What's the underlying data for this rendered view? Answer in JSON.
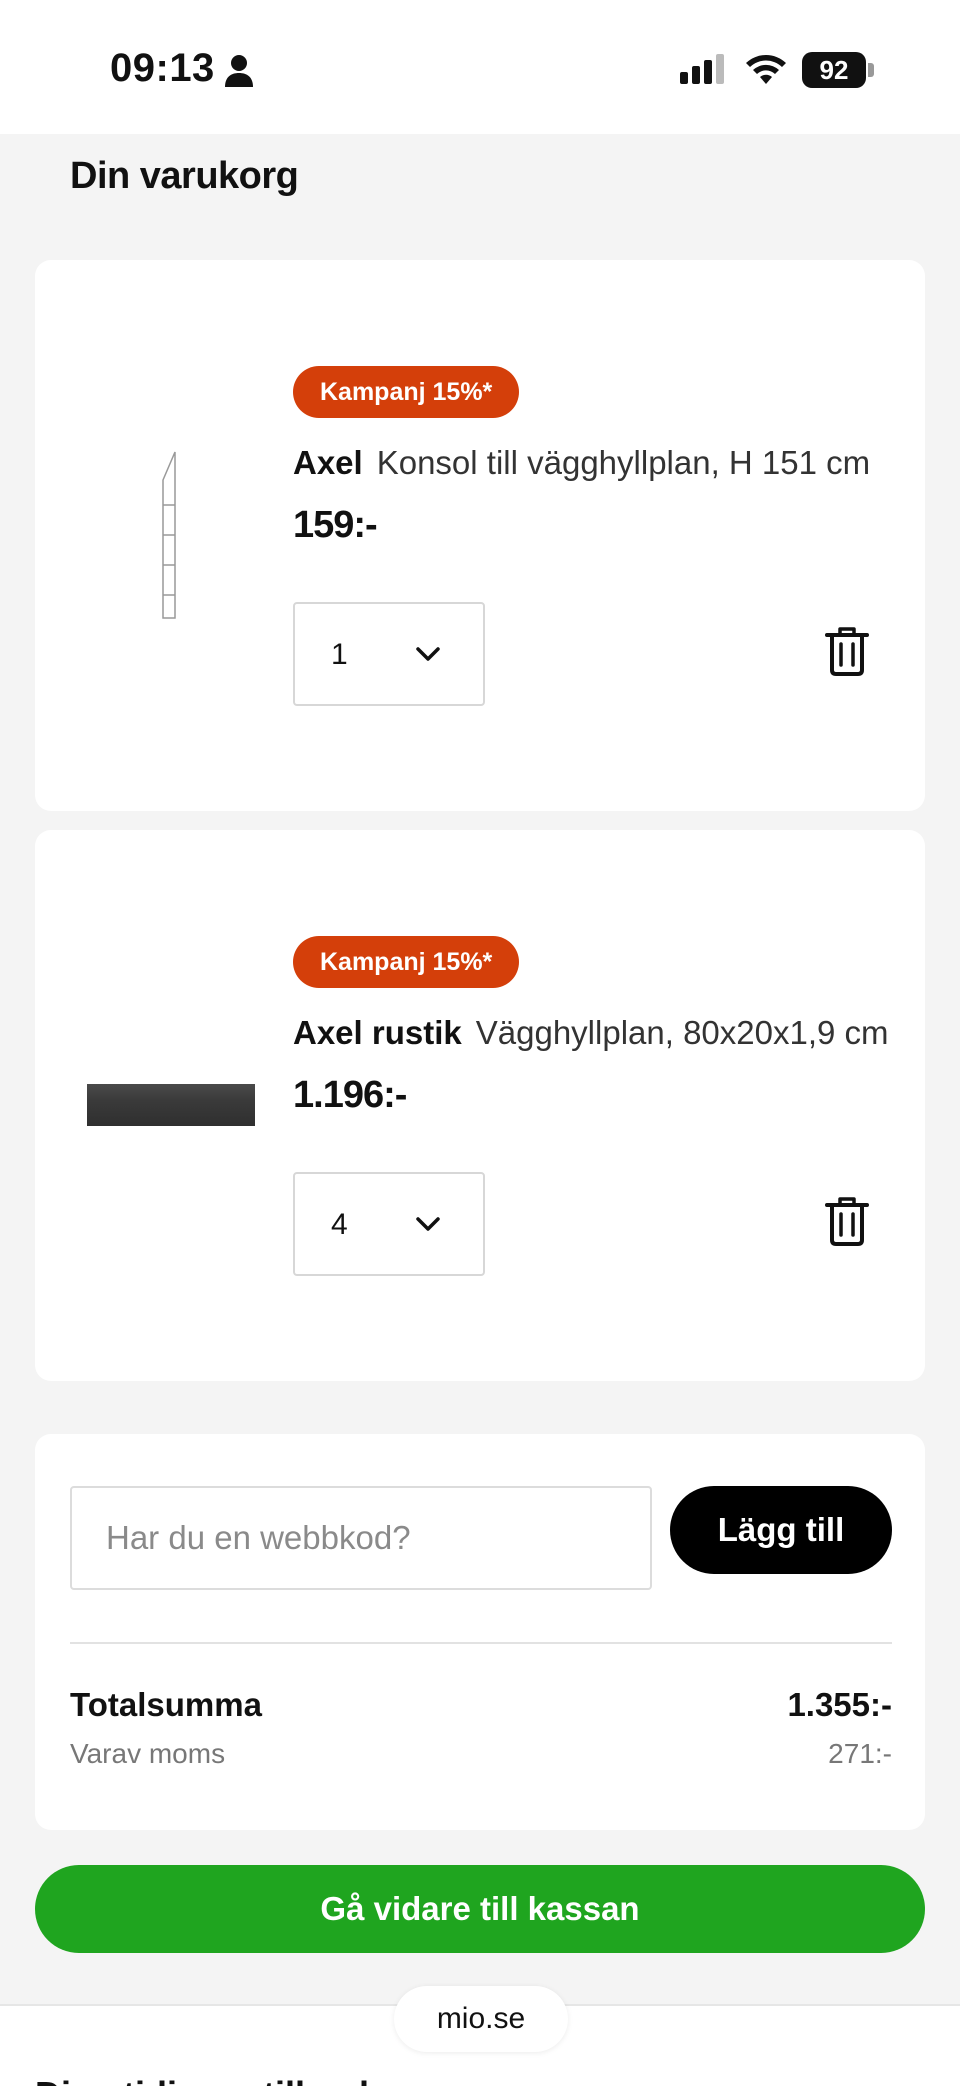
{
  "status_bar": {
    "time": "09:13",
    "battery": "92"
  },
  "cart": {
    "title": "Din varukorg",
    "items": [
      {
        "badge": "Kampanj 15%*",
        "name": "Axel",
        "description": "Konsol till vägghyllplan, H 151 cm",
        "price": "159:-",
        "quantity": "1"
      },
      {
        "badge": "Kampanj 15%*",
        "name": "Axel rustik",
        "description": "Vägghyllplan, 80x20x1,9 cm",
        "price": "1.196:-",
        "quantity": "4"
      }
    ]
  },
  "summary": {
    "code_placeholder": "Har du en webbkod?",
    "add_label": "Lägg till",
    "total_label": "Totalsumma",
    "total_value": "1.355:-",
    "vat_label": "Varav moms",
    "vat_value": "271:-"
  },
  "checkout_label": "Gå vidare till kassan",
  "next_section_heading": "Dina tidigare tillagda",
  "browser": {
    "url": "mio.se"
  },
  "colors": {
    "campaign_badge": "#d43f0a",
    "checkout_green": "#1fa51f",
    "add_button": "#000000",
    "page_background": "#f4f4f4"
  },
  "icons": [
    "person-icon",
    "signal-icon",
    "wifi-icon",
    "battery-icon",
    "chevron-down-icon",
    "trash-icon"
  ]
}
